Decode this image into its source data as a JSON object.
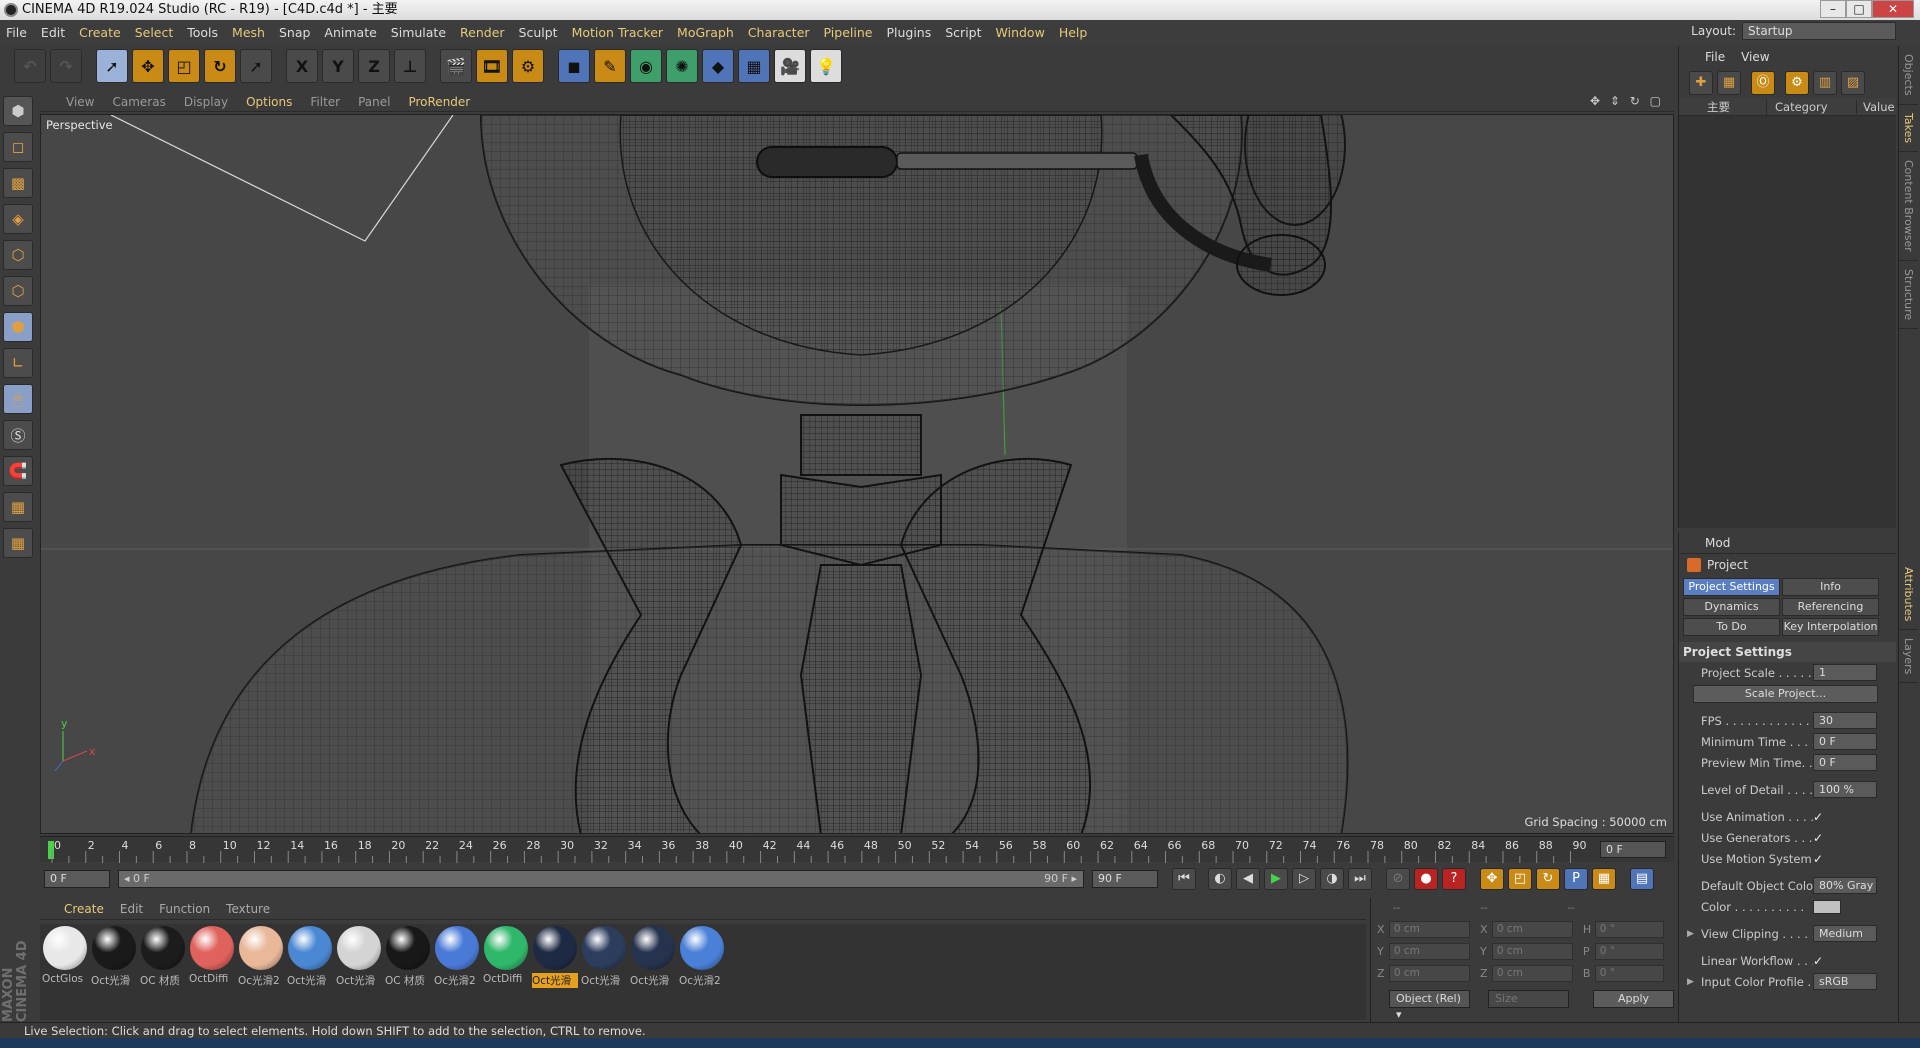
{
  "window": {
    "title": "CINEMA 4D R19.024 Studio (RC - R19) - [C4D.c4d *] - 主要",
    "controls": [
      "–",
      "□",
      "✕"
    ]
  },
  "menubar": {
    "items": [
      "File",
      "Edit",
      "Create",
      "Select",
      "Tools",
      "Mesh",
      "Snap",
      "Animate",
      "Simulate",
      "Render",
      "Sculpt",
      "Motion Tracker",
      "MoGraph",
      "Character",
      "Pipeline",
      "Plugins",
      "Script",
      "Window",
      "Help"
    ]
  },
  "layout": {
    "label": "Layout:",
    "value": "Startup"
  },
  "toolbar": {
    "icons": [
      "undo-icon",
      "redo-icon",
      "live-selection-icon",
      "move-icon",
      "scale-icon",
      "rotate-icon",
      "recent-tool-icon",
      "x-axis-icon",
      "y-axis-icon",
      "z-axis-icon",
      "coordinate-system-icon",
      "render-view-icon",
      "render-picture-viewer-icon",
      "render-settings-icon",
      "cube-icon",
      "pen-icon",
      "subdivision-icon",
      "cloner-icon",
      "deformer-icon",
      "floor-icon",
      "camera-icon",
      "light-icon"
    ],
    "axis_labels": [
      "X",
      "Y",
      "Z"
    ]
  },
  "viewport_menu": {
    "items": [
      "View",
      "Cameras",
      "Display",
      "Options",
      "Filter",
      "Panel",
      "ProRender"
    ]
  },
  "viewport": {
    "label": "Perspective",
    "grid_spacing": "Grid Spacing : 50000 cm",
    "axis_y": "y",
    "axis_x": "x"
  },
  "timeline": {
    "ticks": [
      "0",
      "2",
      "4",
      "6",
      "8",
      "10",
      "12",
      "14",
      "16",
      "18",
      "20",
      "22",
      "24",
      "26",
      "28",
      "30",
      "32",
      "34",
      "36",
      "38",
      "40",
      "42",
      "44",
      "46",
      "48",
      "50",
      "52",
      "54",
      "56",
      "58",
      "60",
      "62",
      "64",
      "66",
      "68",
      "70",
      "72",
      "74",
      "76",
      "78",
      "80",
      "82",
      "84",
      "86",
      "88",
      "90"
    ],
    "current_frame": "0 F"
  },
  "transport": {
    "start": "0 F",
    "range_start": "◂ 0 F",
    "range_end": "90 F ▸",
    "end": "90 F",
    "buttons": [
      "⏮",
      "◐",
      "◀",
      "▶",
      "▷",
      "◑",
      "⏭"
    ]
  },
  "material_menu": {
    "items": [
      "Create",
      "Edit",
      "Function",
      "Texture"
    ]
  },
  "materials": [
    {
      "name": "OctGlos",
      "color": "#e8e8e8"
    },
    {
      "name": "Oct光滑",
      "color": "#1a1a1a"
    },
    {
      "name": "OC 材质",
      "color": "#1c1c1c"
    },
    {
      "name": "OctDiffi",
      "color": "#e0625c"
    },
    {
      "name": "Oc光滑2",
      "color": "#e9b899"
    },
    {
      "name": "Oct光滑",
      "color": "#4a88d4"
    },
    {
      "name": "Oct光滑",
      "color": "#d4d4d4"
    },
    {
      "name": "OC 材质",
      "color": "#181818"
    },
    {
      "name": "Oc光滑2",
      "color": "#4a7ad8"
    },
    {
      "name": "OctDiffi",
      "color": "#2fb86a"
    },
    {
      "name": "Oct光滑",
      "color": "#1e2a44"
    },
    {
      "name": "Oct光滑",
      "color": "#2c3d5e"
    },
    {
      "name": "Oct光滑",
      "color": "#26334e"
    },
    {
      "name": "Oc光滑2",
      "color": "#4a80d8"
    }
  ],
  "coords": {
    "headers": [
      "--",
      "--",
      "--"
    ],
    "rows": [
      {
        "a1": "X",
        "v1": "0 cm",
        "a2": "X",
        "v2": "0 cm",
        "a3": "H",
        "v3": "0 °"
      },
      {
        "a1": "Y",
        "v1": "0 cm",
        "a2": "Y",
        "v2": "0 cm",
        "a3": "P",
        "v3": "0 °"
      },
      {
        "a1": "Z",
        "v1": "0 cm",
        "a2": "Z",
        "v2": "0 cm",
        "a3": "B",
        "v3": "0 °"
      }
    ],
    "mode": "Object (Rel) ▾",
    "size": "Size",
    "apply": "Apply"
  },
  "status": "Live Selection: Click and drag to select elements. Hold down SHIFT to add to the selection, CTRL to remove.",
  "objects_panel": {
    "menu": [
      "File",
      "View"
    ],
    "col_name": "主要",
    "col_category": "Category",
    "col_value": "Value"
  },
  "side_tabs": [
    "Objects",
    "Takes",
    "Content Browser",
    "Structure",
    "Attributes",
    "Layers"
  ],
  "attributes": {
    "menu": "Mod",
    "title": "Project",
    "tabs": [
      "Project Settings",
      "Info",
      "Dynamics",
      "Referencing",
      "To Do",
      "Key Interpolation"
    ],
    "section": "Project Settings",
    "project_scale": {
      "label": "Project Scale . . . . . .",
      "value": "1"
    },
    "scale_button": "Scale Project...",
    "fps": {
      "label": "FPS . . . . . . . . . . . . . .",
      "value": "30"
    },
    "min_time": {
      "label": "Minimum Time . . . . .",
      "value": "0 F"
    },
    "preview_min": {
      "label": "Preview Min Time. . .",
      "value": "0 F"
    },
    "lod": {
      "label": "Level of Detail . . . . .",
      "value": "100 %"
    },
    "use_animation": "Use Animation . . . . .",
    "use_generators": "Use Generators . . . .",
    "use_motion": "Use Motion System",
    "check": "✓",
    "default_color": {
      "label": "Default Object Color",
      "value": "80% Gray"
    },
    "color": {
      "label": "Color . . . . . . . . . ."
    },
    "view_clipping": {
      "label": "View Clipping . . . . .",
      "value": "Medium"
    },
    "linear_workflow": "Linear Workflow . . .",
    "input_profile": {
      "label": "Input Color Profile . .",
      "value": "sRGB"
    }
  }
}
